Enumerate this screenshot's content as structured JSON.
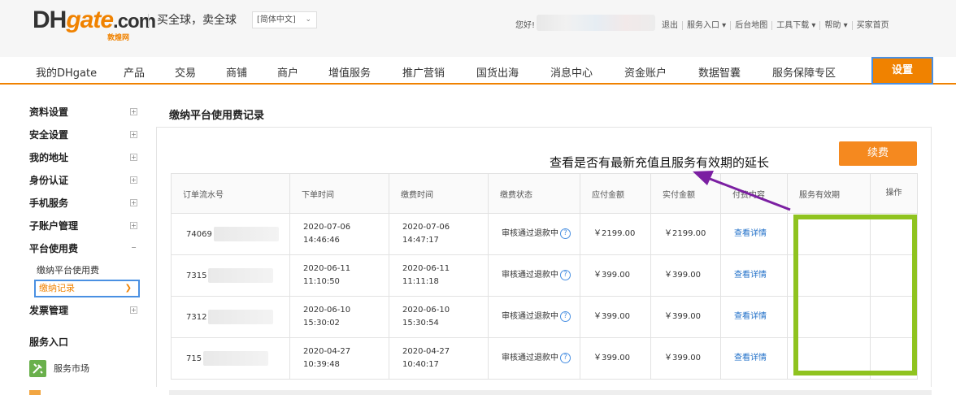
{
  "header": {
    "logo_dh": "DH",
    "logo_gate": "gate",
    "logo_com": ".com",
    "logo_sub": "敦煌网",
    "slogan": "买全球，卖全球",
    "language": "[简体中文]",
    "greeting": "您好!",
    "links": [
      "退出",
      "服务入口 ▾",
      "后台地图",
      "工具下载 ▾",
      "帮助 ▾",
      "买家首页"
    ]
  },
  "nav": {
    "items": [
      "我的DHgate",
      "产品",
      "交易",
      "商铺",
      "商户",
      "增值服务",
      "推广营销",
      "国货出海",
      "消息中心",
      "资金账户",
      "数据智囊",
      "服务保障专区"
    ],
    "settings": "设置"
  },
  "sidebar": {
    "groups": [
      "资料设置",
      "安全设置",
      "我的地址",
      "身份认证",
      "手机服务",
      "子账户管理"
    ],
    "platform_fee": "平台使用费",
    "platform_fee_sub": "缴纳平台使用费",
    "active_item": "缴纳记录",
    "invoice": "发票管理",
    "entry_title": "服务入口",
    "market": "服务市场"
  },
  "content": {
    "title": "缴纳平台使用费记录",
    "annotation": "查看是否有最新充值且服务有效期的延长",
    "renew_button": "续费",
    "columns": [
      "订单流水号",
      "下单时间",
      "缴费时间",
      "缴费状态",
      "应付金额",
      "实付金额",
      "付费内容",
      "服务有效期",
      "操作"
    ],
    "rows": [
      {
        "order": "74069",
        "order_time_d": "2020-07-06",
        "order_time_t": "14:46:46",
        "pay_time_d": "2020-07-06",
        "pay_time_t": "14:47:17",
        "status": "审核通过退款中",
        "due": "￥2199.00",
        "paid": "￥2199.00",
        "content": "查看详情"
      },
      {
        "order": "7315",
        "order_time_d": "2020-06-11",
        "order_time_t": "11:10:50",
        "pay_time_d": "2020-06-11",
        "pay_time_t": "11:11:18",
        "status": "审核通过退款中",
        "due": "￥399.00",
        "paid": "￥399.00",
        "content": "查看详情"
      },
      {
        "order": "7312",
        "order_time_d": "2020-06-10",
        "order_time_t": "15:30:02",
        "pay_time_d": "2020-06-10",
        "pay_time_t": "15:30:54",
        "status": "审核通过退款中",
        "due": "￥399.00",
        "paid": "￥399.00",
        "content": "查看详情"
      },
      {
        "order": "715",
        "order_time_d": "2020-04-27",
        "order_time_t": "10:39:48",
        "pay_time_d": "2020-04-27",
        "pay_time_t": "10:40:17",
        "status": "审核通过退款中",
        "due": "￥399.00",
        "paid": "￥399.00",
        "content": "查看详情"
      }
    ]
  },
  "colors": {
    "brand_orange": "#f08200",
    "highlight_blue": "#4a90e2",
    "annotation_green": "#8fc31f",
    "annotation_arrow": "#7b1fa2"
  }
}
